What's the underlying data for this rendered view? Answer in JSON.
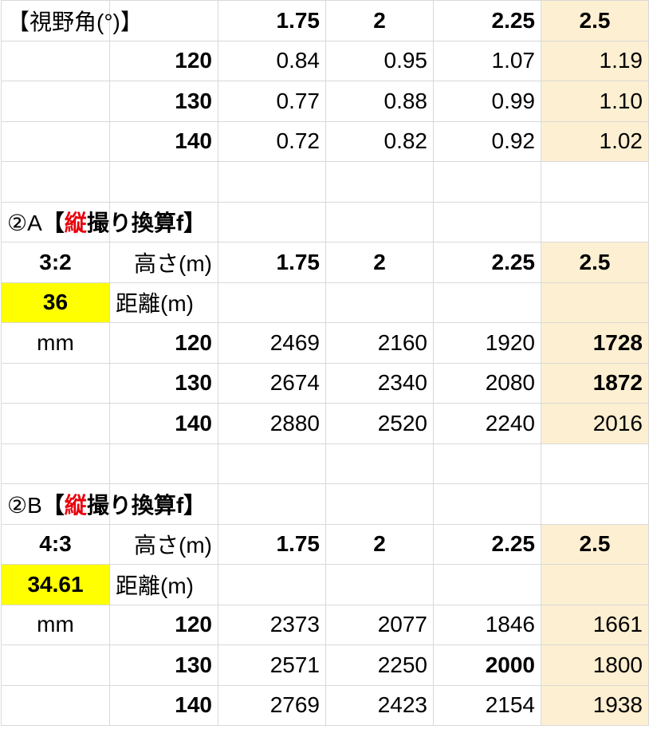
{
  "view_angle_table": {
    "title": "【視野角(°)】",
    "headers": [
      "1.75",
      "2",
      "2.25",
      "2.5"
    ],
    "rows": [
      {
        "label": "120",
        "values": [
          "0.84",
          "0.95",
          "1.07",
          "1.19"
        ]
      },
      {
        "label": "130",
        "values": [
          "0.77",
          "0.88",
          "0.99",
          "1.10"
        ]
      },
      {
        "label": "140",
        "values": [
          "0.72",
          "0.82",
          "0.92",
          "1.02"
        ]
      }
    ]
  },
  "section_a": {
    "title_prefix": "②A",
    "title_open": "【",
    "title_highlight": "縦",
    "title_rest": "撮り換算f】",
    "ratio": "3:2",
    "height_label": "高さ(m)",
    "headers": [
      "1.75",
      "2",
      "2.25",
      "2.5"
    ],
    "sensor_value": "36",
    "distance_label": "距離(m)",
    "unit": "mm",
    "rows": [
      {
        "label": "120",
        "values": [
          "2469",
          "2160",
          "1920",
          "1728"
        ]
      },
      {
        "label": "130",
        "values": [
          "2674",
          "2340",
          "2080",
          "1872"
        ]
      },
      {
        "label": "140",
        "values": [
          "2880",
          "2520",
          "2240",
          "2016"
        ]
      }
    ]
  },
  "section_b": {
    "title_prefix": "②B",
    "title_open": "【",
    "title_highlight": "縦",
    "title_rest": "撮り換算f】",
    "ratio": "4:3",
    "height_label": "高さ(m)",
    "headers": [
      "1.75",
      "2",
      "2.25",
      "2.5"
    ],
    "sensor_value": "34.61",
    "distance_label": "距離(m)",
    "unit": "mm",
    "rows": [
      {
        "label": "120",
        "values": [
          "2373",
          "2077",
          "1846",
          "1661"
        ]
      },
      {
        "label": "130",
        "values": [
          "2571",
          "2250",
          "2000",
          "1800"
        ]
      },
      {
        "label": "140",
        "values": [
          "2769",
          "2423",
          "2154",
          "1938"
        ]
      }
    ]
  },
  "colors": {
    "accent_red": "#e8000b",
    "value_blue": "#1a1ae6",
    "highlight_yellow": "#ffff00",
    "column_peach": "#fdefd1"
  }
}
